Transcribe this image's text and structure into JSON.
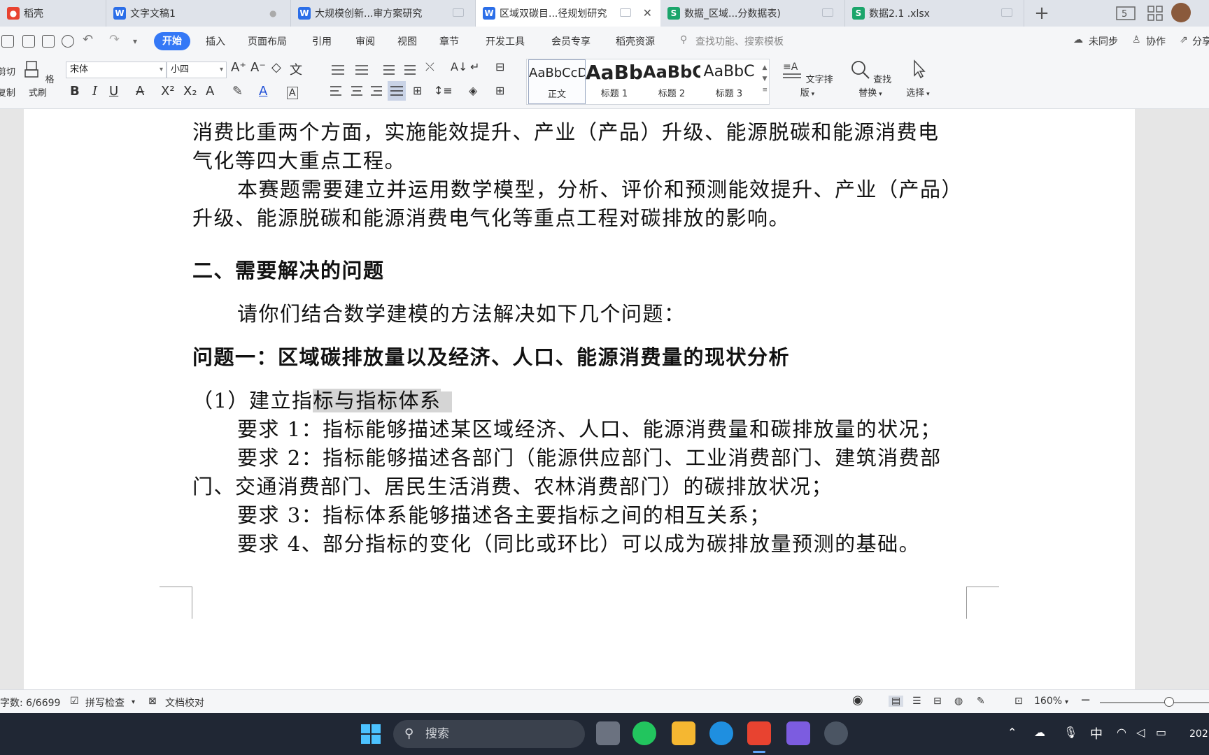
{
  "tabs": [
    {
      "label": "稻壳",
      "icon": "docer-icon"
    },
    {
      "label": "文字文稿1",
      "icon": "wps-writer-icon"
    },
    {
      "label": "大规模创新...审方案研究",
      "icon": "wps-writer-icon"
    },
    {
      "label": "区域双碳目...径规划研究",
      "icon": "wps-writer-icon",
      "active": true
    },
    {
      "label": "数据_区域...分数据表)",
      "icon": "wps-sheet-icon"
    },
    {
      "label": "数据2.1 .xlsx",
      "icon": "wps-sheet-icon"
    }
  ],
  "tab_icon_letters": {
    "writer": "W",
    "sheet": "S"
  },
  "window_controls": {
    "page_count": "5"
  },
  "menu": {
    "items": [
      "开始",
      "插入",
      "页面布局",
      "引用",
      "审阅",
      "视图",
      "章节",
      "开发工具",
      "会员专享",
      "稻壳资源"
    ],
    "search_placeholder": "查找功能、搜索模板",
    "sync": "未同步",
    "collab": "协作",
    "share": "分享"
  },
  "ribbon": {
    "cut": "剪切",
    "copy": "复制",
    "format_painter": "格式刷",
    "font_name": "宋体",
    "font_size": "小四",
    "styles": [
      {
        "sample": "AaBbCcDd",
        "name": "正文"
      },
      {
        "sample": "AaBb",
        "name": "标题 1"
      },
      {
        "sample": "AaBbC",
        "name": "标题 2"
      },
      {
        "sample": "AaBbC",
        "name": "标题 3"
      }
    ],
    "text_layout": "文字排版",
    "find_replace": "查找替换",
    "select": "选择"
  },
  "document": {
    "lines": [
      "消费比重两个方面，实施能效提升、产业（产品）升级、能源脱碳和能源消费电",
      "气化等四大重点工程。",
      "本赛题需要建立并运用数学模型，分析、评价和预测能效提升、产业（产品）",
      "升级、能源脱碳和能源消费电气化等重点工程对碳排放的影响。",
      "二、需要解决的问题",
      "请你们结合数学建模的方法解决如下几个问题：",
      "问题一：区域碳排放量以及经济、人口、能源消费量的现状分析",
      "（1）建立指",
      "标与指标体系",
      "要求 1：指标能够描述某区域经济、人口、能源消费量和碳排放量的状况；",
      "要求 2：指标能够描述各部门（能源供应部门、工业消费部门、建筑消费部",
      "门、交通消费部门、居民生活消费、农林消费部门）的碳排放状况；",
      "要求 3：指标体系能够描述各主要指标之间的相互关系；",
      "要求 4、部分指标的变化（同比或环比）可以成为碳排放量预测的基础。"
    ]
  },
  "status": {
    "word_count": "字数: 6/6699",
    "spell_check": "拼写检查",
    "doc_proof": "文档校对",
    "zoom": "160%"
  },
  "taskbar": {
    "search": "搜索",
    "ime": "中",
    "clock": "202"
  }
}
